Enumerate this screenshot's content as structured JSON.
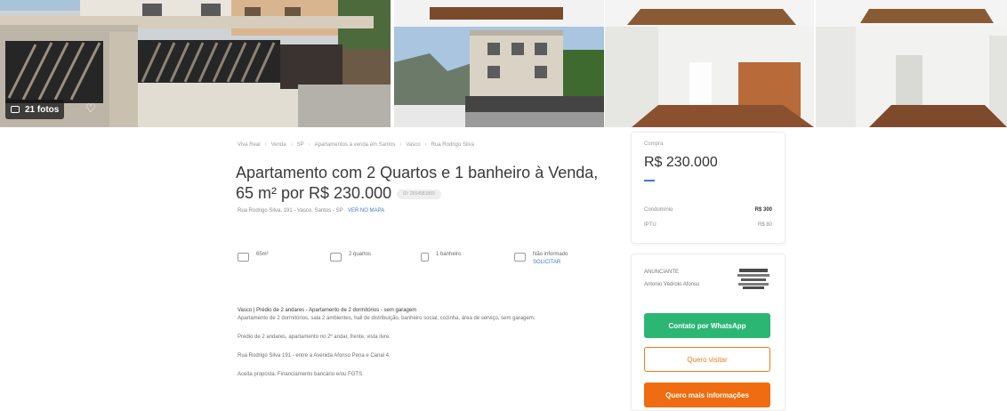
{
  "gallery": {
    "photo_count": "21 fotos",
    "photos": [
      "exterior-gate",
      "building-facade",
      "living-room",
      "living-room-2"
    ]
  },
  "breadcrumb": [
    "Viva Real",
    "Venda",
    "SP",
    "Apartamentos à venda em Santos",
    "Vasco",
    "Rua Rodrigo Silva"
  ],
  "listing": {
    "title": "Apartamento com 2 Quartos e 1 banheiro à Venda, 65 m² por R$ 230.000",
    "code_tag": "ID: 2654581893",
    "address": "Rua Rodrigo Silva, 191 - Vasco, Santos - SP",
    "map_link": "VER NO MAPA"
  },
  "features": [
    {
      "icon": "area-icon",
      "label": "65m²"
    },
    {
      "icon": "bed-icon",
      "label": "2 quartos"
    },
    {
      "icon": "bath-icon",
      "label": "1 banheiro"
    },
    {
      "icon": "parking-icon",
      "label": "Não informado",
      "link": "SOLICITAR"
    }
  ],
  "description": {
    "lead": "Vasco | Prédio de 2 andares - Apartamento de 2 dormitórios - sem garagem",
    "paragraphs": [
      "Apartamento de 2 dormitórios, sala 2 ambientes, hall de distribuição, banheiro social, cozinha, área de serviço, sem garagem.",
      "Prédio de 2 andares, apartamento no 2º andar, frente, vista livre.",
      "Rua Rodrigo Silva 191 - entre a Avenida Afonso Pena e Canal 4.",
      "Aceita proposta. Financiamento bancário e/ou FGTS."
    ]
  },
  "price_card": {
    "label": "Compra",
    "price": "R$ 230.000",
    "rows": [
      {
        "label": "Condomínio",
        "value": "R$ 300"
      },
      {
        "label": "IPTU",
        "value": "R$ 80"
      }
    ]
  },
  "advertiser": {
    "label": "ANUNCIANTE",
    "name": "Antonio Vedrolo Afonso",
    "whatsapp_button": "Contato por WhatsApp",
    "visit_button": "Quero visitar",
    "info_button": "Quero mais informações"
  },
  "colors": {
    "accent_blue": "#3e7bcf",
    "whatsapp_green": "#2bb673",
    "orange": "#ef6c10"
  }
}
